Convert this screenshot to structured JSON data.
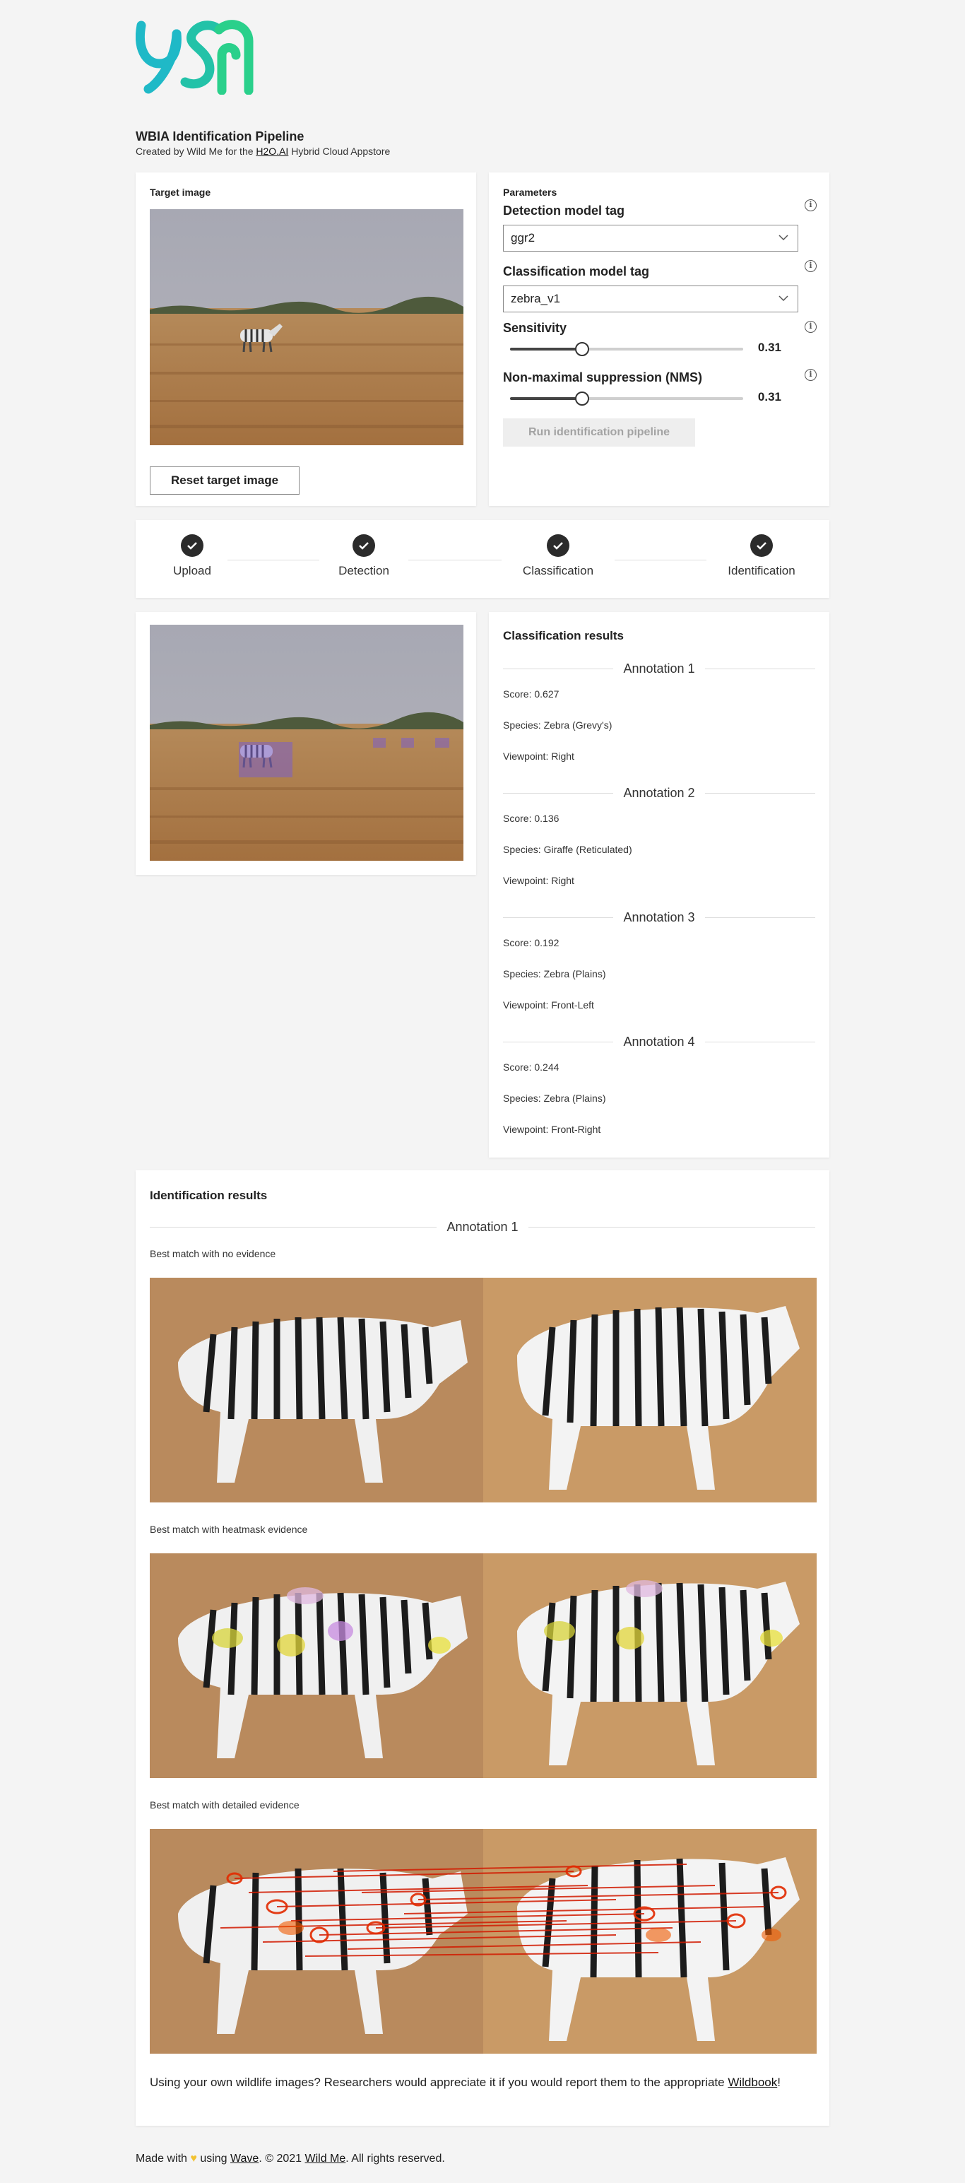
{
  "app": {
    "title": "WBIA Identification Pipeline",
    "subtitle_prefix": "Created by Wild Me for the ",
    "subtitle_link": "H2O.AI",
    "subtitle_suffix": " Hybrid Cloud Appstore",
    "logo_icon": "wildme-logo-icon"
  },
  "colors": {
    "logo_teal": "#1fb9c7",
    "logo_green": "#2ad08b",
    "dark": "#2b2b2b",
    "annotation_box": "#7b5fc8"
  },
  "target": {
    "heading": "Target image",
    "reset_label": "Reset target image"
  },
  "params": {
    "heading": "Parameters",
    "detection_label": "Detection model tag",
    "detection_value": "ggr2",
    "classification_label": "Classification model tag",
    "classification_value": "zebra_v1",
    "sensitivity_label": "Sensitivity",
    "sensitivity_value": "0.31",
    "sensitivity_level": 0.31,
    "nms_label": "Non-maximal suppression (NMS)",
    "nms_value": "0.31",
    "nms_level": 0.31,
    "run_label": "Run identification pipeline"
  },
  "steps": [
    {
      "label": "Upload",
      "icon": "check-icon"
    },
    {
      "label": "Detection",
      "icon": "check-icon"
    },
    {
      "label": "Classification",
      "icon": "check-icon"
    },
    {
      "label": "Identification",
      "icon": "check-icon"
    }
  ],
  "classification": {
    "heading": "Classification results",
    "annotations": [
      {
        "title": "Annotation 1",
        "score": "Score: 0.627",
        "species": "Species: Zebra (Grevy's)",
        "viewpoint": "Viewpoint: Right"
      },
      {
        "title": "Annotation 2",
        "score": "Score: 0.136",
        "species": "Species: Giraffe (Reticulated)",
        "viewpoint": "Viewpoint: Right"
      },
      {
        "title": "Annotation 3",
        "score": "Score: 0.192",
        "species": "Species: Zebra (Plains)",
        "viewpoint": "Viewpoint: Front-Left"
      },
      {
        "title": "Annotation 4",
        "score": "Score: 0.244",
        "species": "Species: Zebra (Plains)",
        "viewpoint": "Viewpoint: Front-Right"
      }
    ]
  },
  "identification": {
    "heading": "Identification results",
    "annotation_title": "Annotation 1",
    "match_no_evidence": "Best match with no evidence",
    "match_heatmask": "Best match with heatmask evidence",
    "match_detailed": "Best match with detailed evidence",
    "footer_prefix": "Using your own wildlife images? Researchers would appreciate it if you would report them to the appropriate ",
    "footer_link": "Wildbook",
    "footer_suffix": "!"
  },
  "footer": {
    "prefix": "Made with ",
    "heart_icon": "heart-icon",
    "using": " using ",
    "wave_link": "Wave",
    "copyright": ". © 2021 ",
    "wildme_link": "Wild Me",
    "suffix": ". All rights reserved."
  }
}
